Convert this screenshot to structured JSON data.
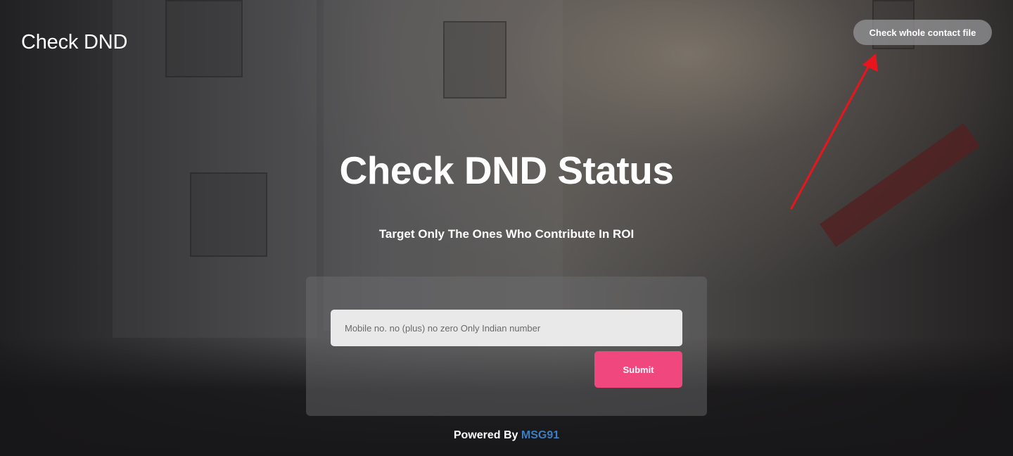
{
  "header": {
    "brand": "Check DND",
    "check_file_button": "Check whole contact file"
  },
  "hero": {
    "title": "Check DND Status",
    "subtitle": "Target Only The Ones Who Contribute In ROI"
  },
  "form": {
    "mobile_placeholder": "Mobile no. no (plus) no zero Only Indian number",
    "mobile_value": "",
    "submit_label": "Submit"
  },
  "footer": {
    "powered_by": "Powered By",
    "provider_link": "MSG91"
  },
  "colors": {
    "submit": "#f0487e",
    "link": "#3a7fc4",
    "annotation_arrow": "#e8161c"
  },
  "annotation": {
    "icon": "red-arrow-pointing-to-button"
  }
}
